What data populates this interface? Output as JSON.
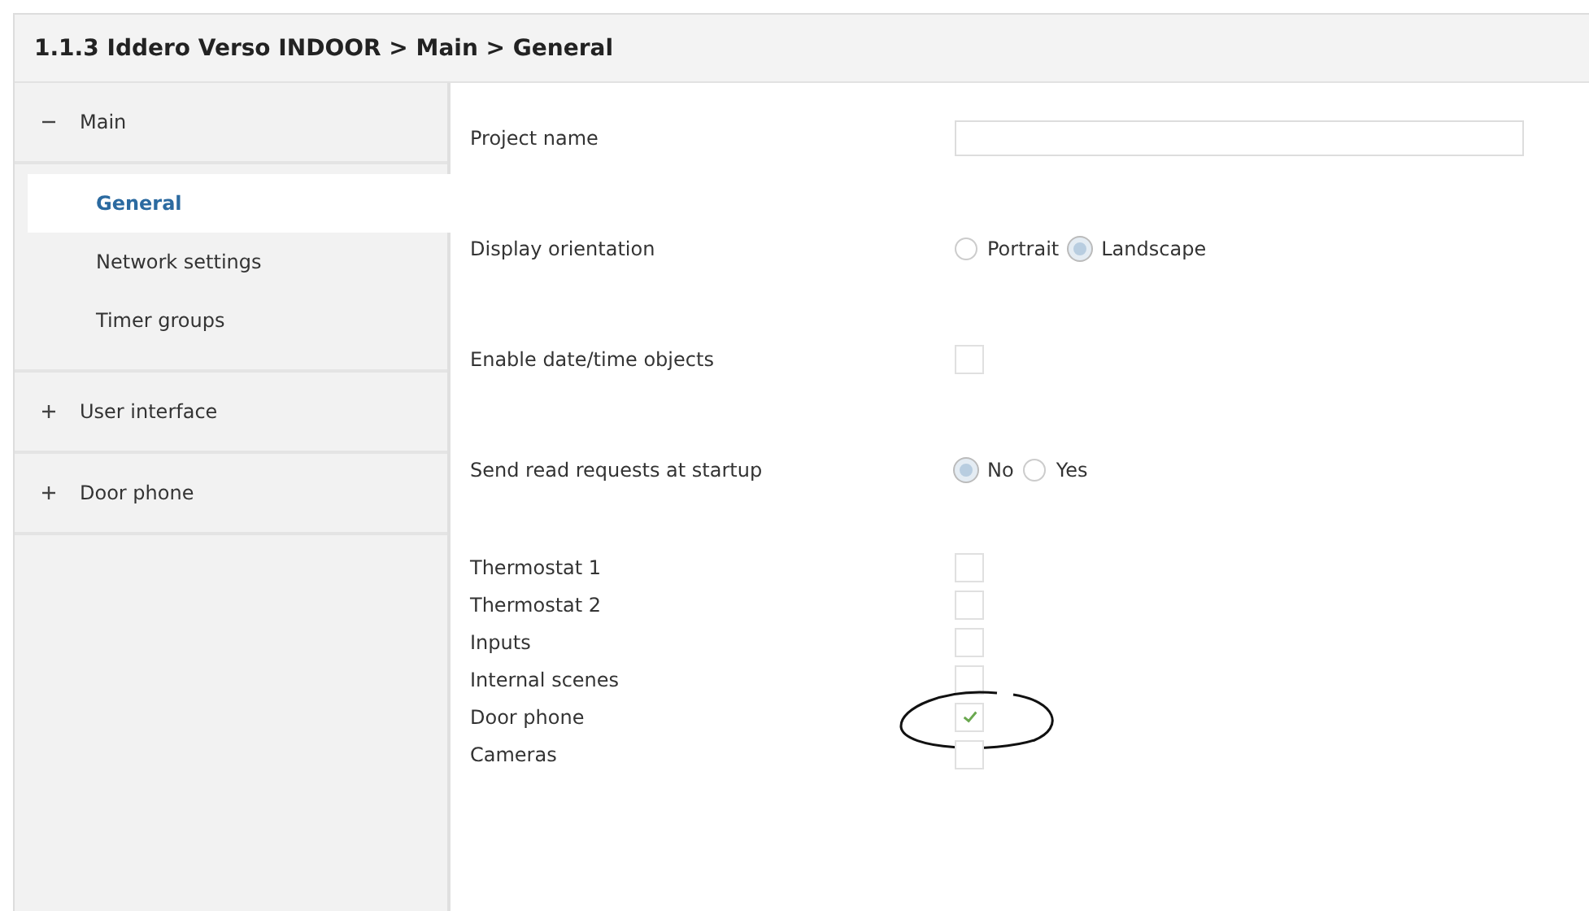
{
  "window": {
    "title": "1.1.3 Iddero Verso INDOOR > Main > General"
  },
  "sidebar": {
    "items": [
      {
        "label": "Main",
        "expanded": true,
        "children": [
          {
            "label": "General",
            "selected": true
          },
          {
            "label": "Network settings",
            "selected": false
          },
          {
            "label": "Timer groups",
            "selected": false
          }
        ]
      },
      {
        "label": "User interface",
        "expanded": false
      },
      {
        "label": "Door phone",
        "expanded": false
      }
    ]
  },
  "settings": [
    {
      "kind": "text",
      "label": "Project name"
    },
    {
      "kind": "radio",
      "label": "Display orientation",
      "options": [
        {
          "label": "Portrait",
          "selected": false
        },
        {
          "label": "Landscape",
          "selected": true
        }
      ]
    },
    {
      "kind": "checkbox",
      "label": "Enable date/time objects",
      "checked": false
    },
    {
      "kind": "radio",
      "label": "Send read requests at startup",
      "options": [
        {
          "label": "No",
          "selected": true
        },
        {
          "label": "Yes",
          "selected": false
        }
      ]
    }
  ],
  "modules": [
    {
      "label": "Thermostat 1",
      "checked": false
    },
    {
      "label": "Thermostat 2",
      "checked": false
    },
    {
      "label": "Inputs",
      "checked": false
    },
    {
      "label": "Internal scenes",
      "checked": false
    },
    {
      "label": "Door phone",
      "checked": true,
      "circled": true
    },
    {
      "label": "Cameras",
      "checked": false
    }
  ]
}
